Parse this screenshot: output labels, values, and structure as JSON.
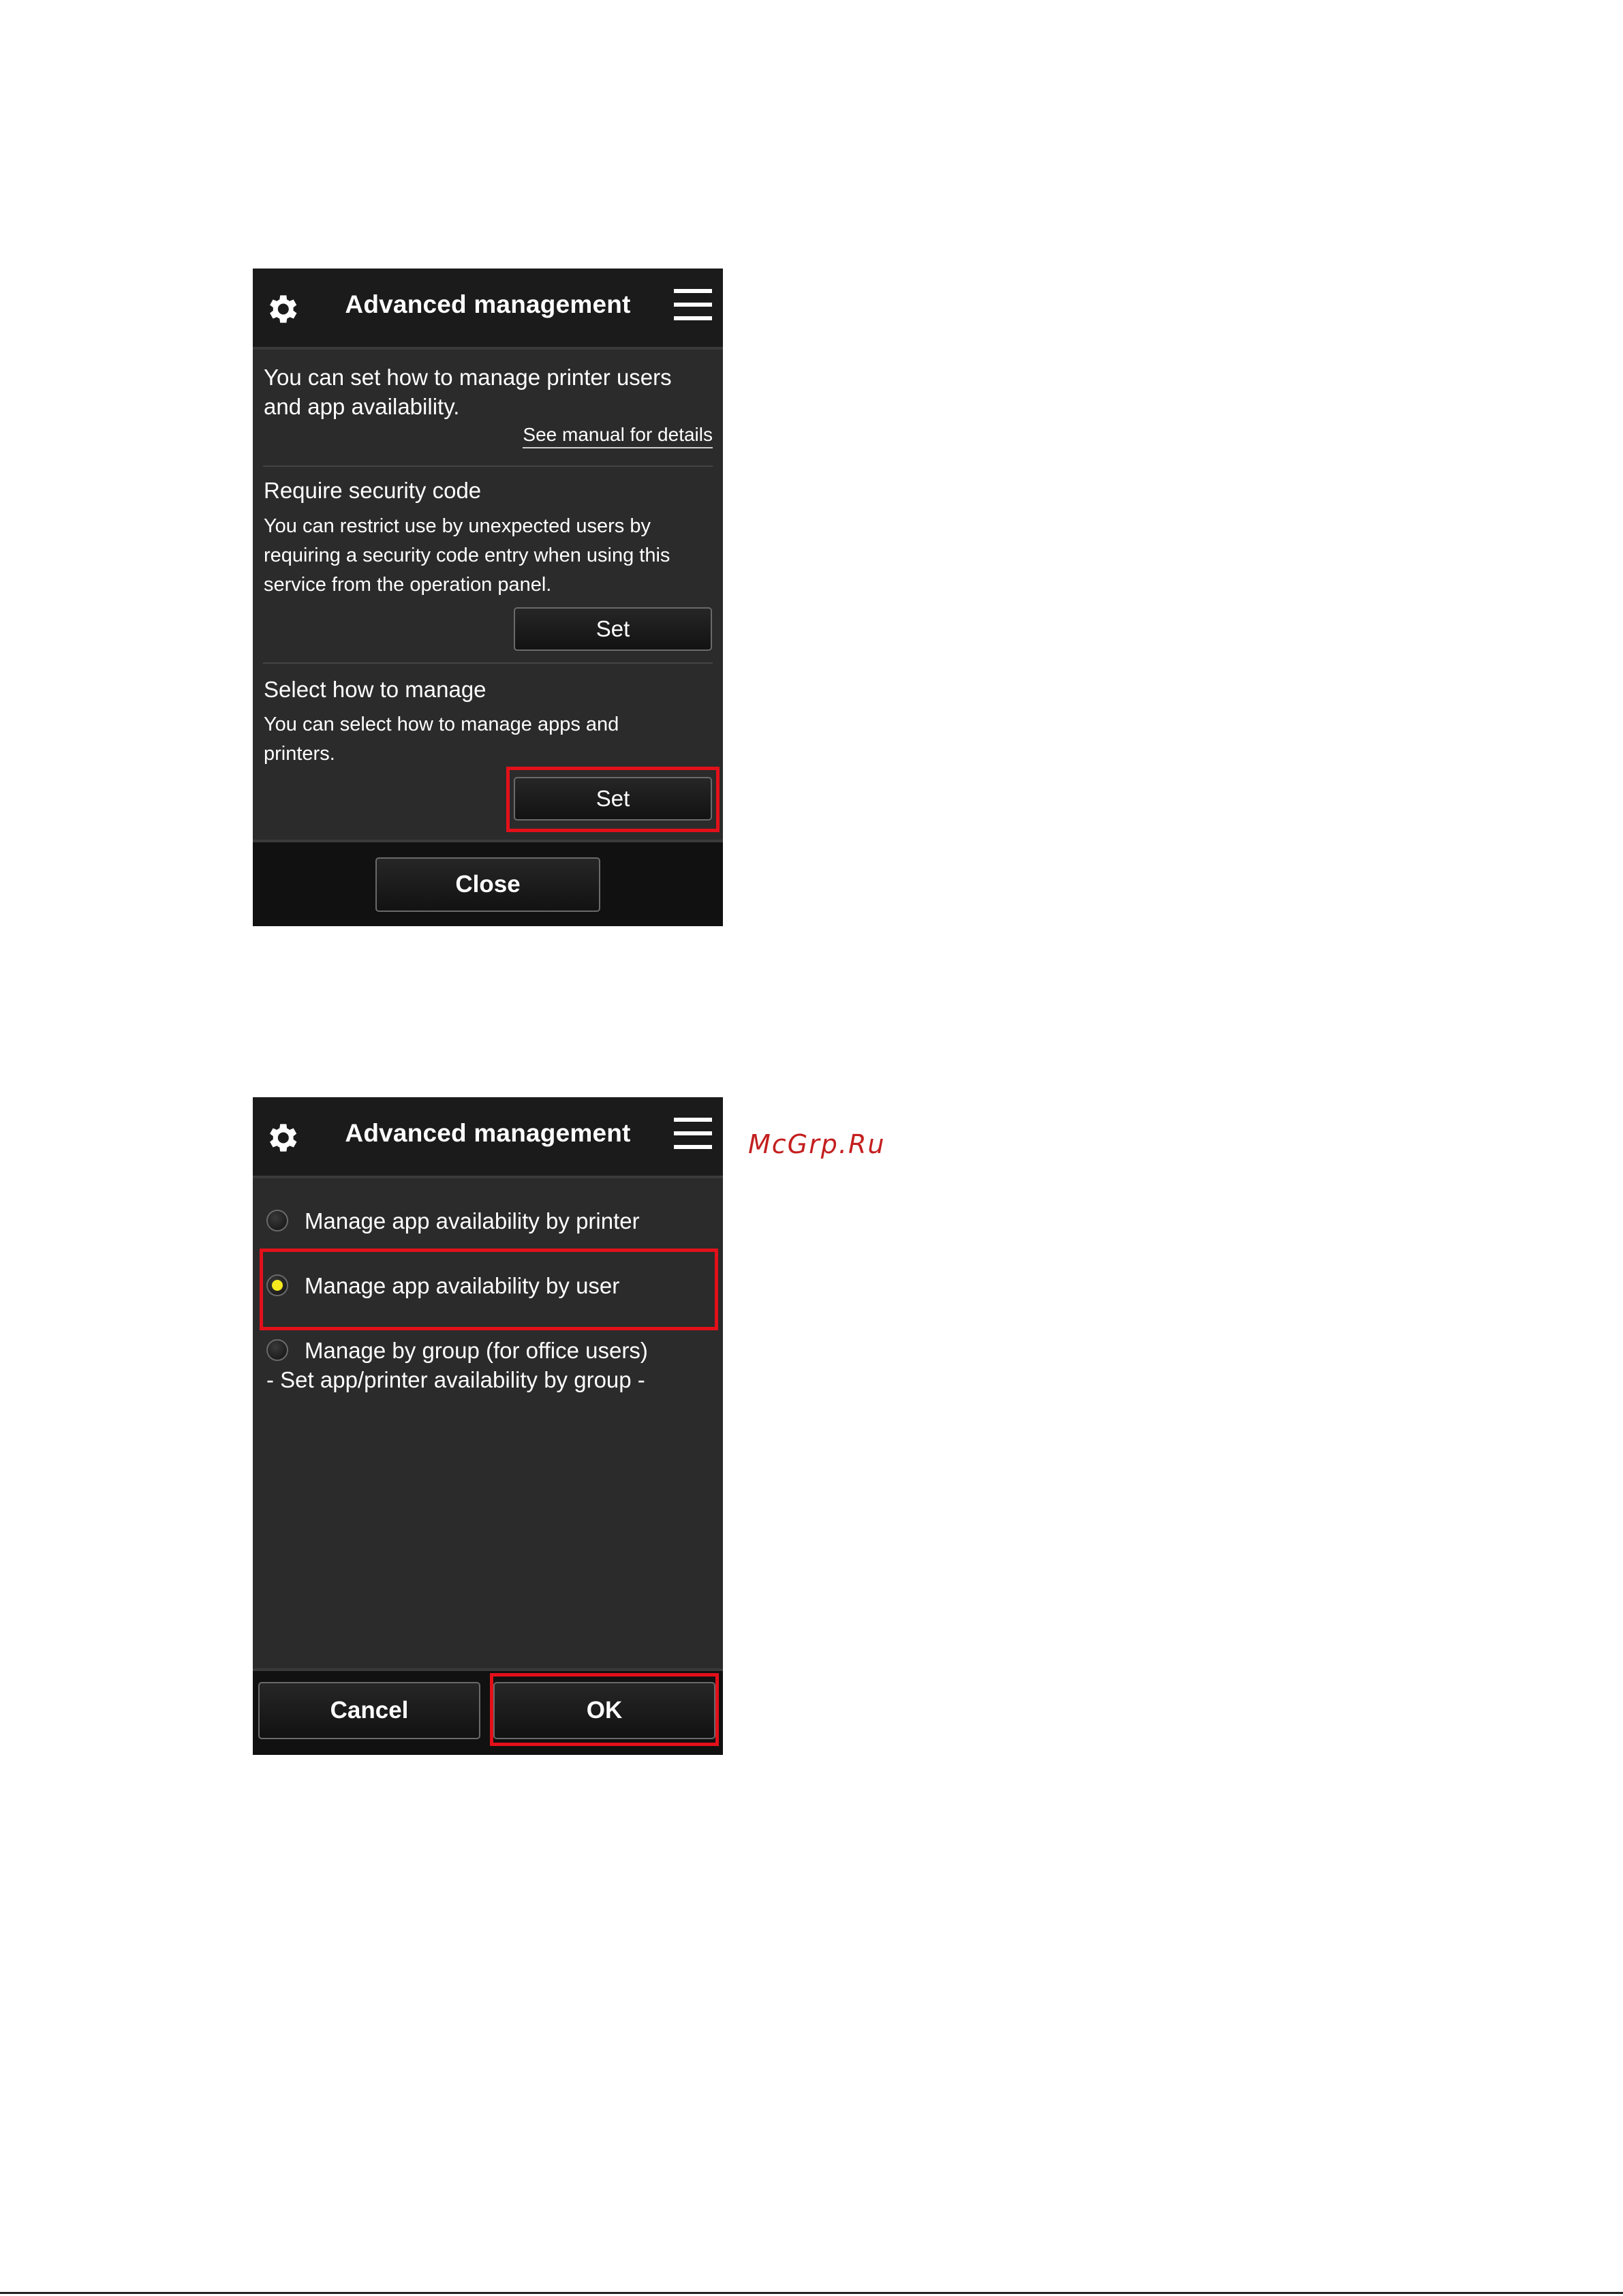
{
  "screen1": {
    "title": "Advanced management",
    "intro": [
      "You can set how to manage printer users",
      "and app availability."
    ],
    "manual_link": "See manual for details",
    "security": {
      "heading": "Require security code",
      "description": [
        "You can restrict use by unexpected users by",
        "requiring a security code entry when using this",
        "service from the operation panel."
      ],
      "button": "Set"
    },
    "manage": {
      "heading": "Select how to manage",
      "description": [
        "You can select how to manage apps and",
        "printers."
      ],
      "button": "Set"
    },
    "close_button": "Close"
  },
  "screen2": {
    "title": "Advanced management",
    "options": [
      {
        "label": "Manage app availability by printer",
        "selected": false
      },
      {
        "label": "Manage app availability by user",
        "selected": true
      },
      {
        "label": "Manage by group (for office users)",
        "sublabel": "- Set app/printer availability by group -",
        "selected": false
      }
    ],
    "cancel_button": "Cancel",
    "ok_button": "OK"
  },
  "watermark": "McGrp.Ru",
  "colors": {
    "highlight": "#e3101a",
    "selected_radio": "#f6ea1e",
    "panel": "#2b2b2b"
  },
  "icons": [
    "gear-icon",
    "hamburger-menu-icon"
  ]
}
